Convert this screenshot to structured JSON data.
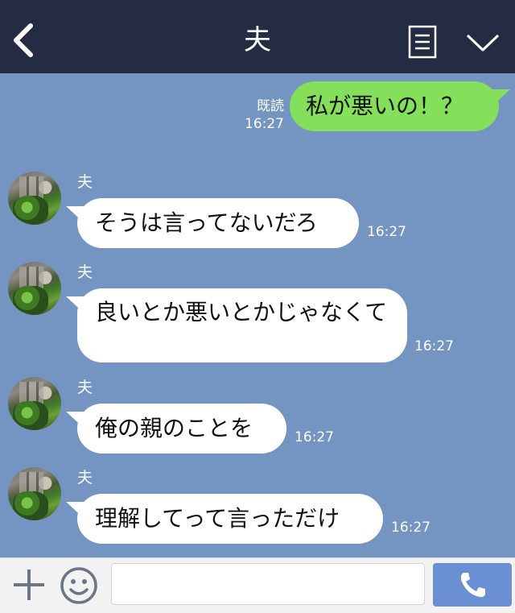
{
  "header": {
    "title": "夫",
    "icons": [
      "back-icon",
      "menu-icon",
      "chevron-down-icon"
    ]
  },
  "messages": {
    "sent": {
      "read_label": "既読",
      "time": "16:27",
      "text": "私が悪いの！？"
    },
    "received": [
      {
        "sender": "夫",
        "text": "そうは言ってないだろ",
        "time": "16:27"
      },
      {
        "sender": "夫",
        "text": "良いとか悪いとかじゃなくて",
        "time": "16:27"
      },
      {
        "sender": "夫",
        "text": "俺の親のことを",
        "time": "16:27"
      },
      {
        "sender": "夫",
        "text": "理解してって言っただけ",
        "time": "16:27"
      }
    ]
  },
  "composer": {
    "value": "",
    "placeholder": "",
    "icons": [
      "plus-icon",
      "smile-icon",
      "phone-icon"
    ]
  },
  "colors": {
    "header_bg": "#232c43",
    "chat_bg": "#7494c2",
    "sent_bubble": "#84e05a",
    "received_bubble": "#ffffff",
    "call_button": "#6a90d3"
  }
}
